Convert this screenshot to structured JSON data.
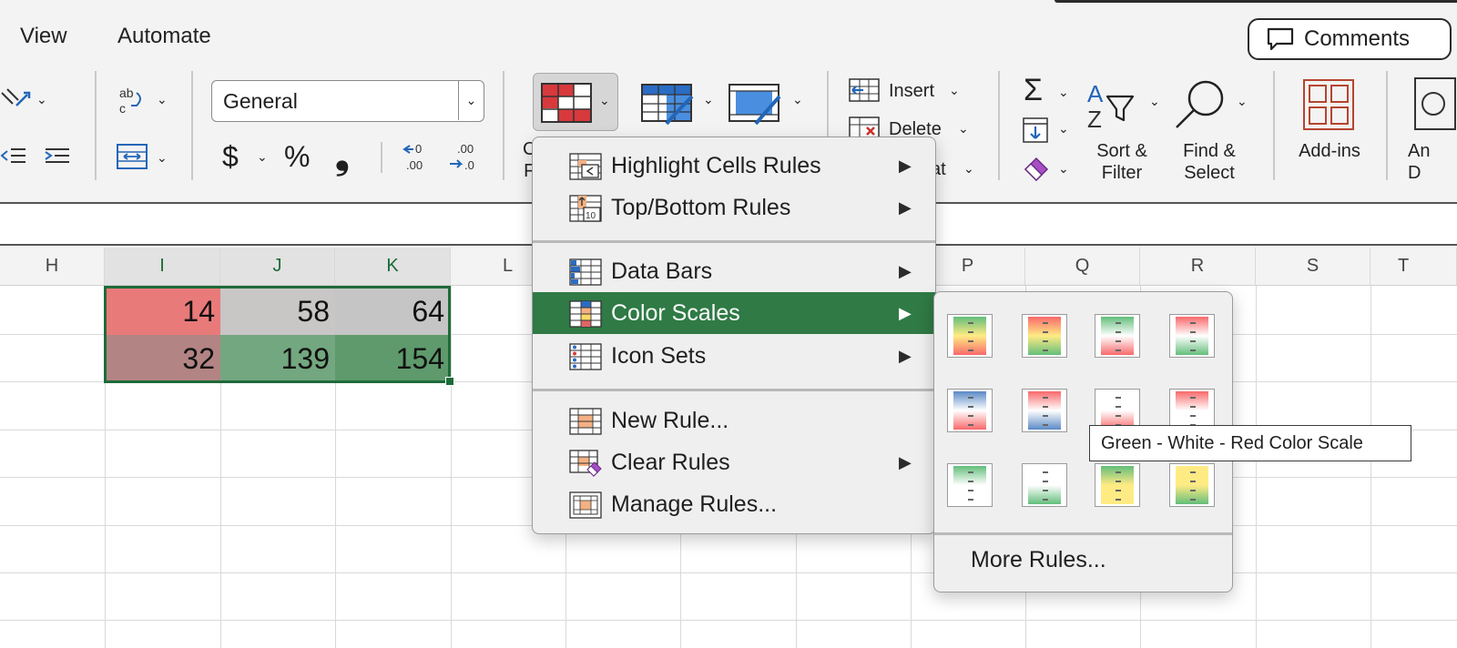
{
  "ribbon": {
    "tabs": [
      "View",
      "Automate"
    ],
    "comments_label": "Comments",
    "number_format": "General",
    "currency_symbol": "$",
    "percent_symbol": "%",
    "comma_symbol": "❟",
    "insert_label": "Insert",
    "delete_label": "Delete",
    "format_label_partial": "at",
    "sort_filter_label": [
      "Sort &",
      "Filter"
    ],
    "find_select_label": [
      "Find &",
      "Select"
    ],
    "addins_label": "Add-ins",
    "partial_label_right": [
      "An",
      "D"
    ]
  },
  "grid": {
    "columns": [
      "H",
      "I",
      "J",
      "K",
      "L",
      "P",
      "Q",
      "R",
      "S",
      "T"
    ],
    "rows": [
      [
        {
          "value": "14",
          "color": "#e97a7a"
        },
        {
          "value": "58",
          "color": "#c9c6c6"
        },
        {
          "value": "64",
          "color": "#c5c5c5"
        }
      ],
      [
        {
          "value": "32",
          "color": "#b38484"
        },
        {
          "value": "139",
          "color": "#73a77f"
        },
        {
          "value": "154",
          "color": "#5e9a6c"
        }
      ]
    ]
  },
  "menu": {
    "items": [
      {
        "label": "Highlight Cells Rules",
        "has_submenu": true
      },
      {
        "label": "Top/Bottom Rules",
        "has_submenu": true
      },
      {
        "label": "Data Bars",
        "has_submenu": true
      },
      {
        "label": "Color Scales",
        "has_submenu": true,
        "highlighted": true
      },
      {
        "label": "Icon Sets",
        "has_submenu": true
      },
      {
        "label": "New Rule...",
        "has_submenu": false
      },
      {
        "label": "Clear Rules",
        "has_submenu": true
      },
      {
        "label": "Manage Rules...",
        "has_submenu": false
      }
    ],
    "highlight_color": "#2f7a45"
  },
  "submenu": {
    "swatches": [
      [
        "#63be7b",
        "#ffeb84",
        "#f8696b"
      ],
      [
        "#f8696b",
        "#ffeb84",
        "#63be7b"
      ],
      [
        "#63be7b",
        "#ffffff",
        "#f8696b"
      ],
      [
        "#f8696b",
        "#ffffff",
        "#63be7b"
      ],
      [
        "#5a8ac6",
        "#ffffff",
        "#f8696b"
      ],
      [
        "#f8696b",
        "#ffffff",
        "#5a8ac6"
      ],
      [
        "#ffffff",
        "#ffffff",
        "#f8696b"
      ],
      [
        "#f8696b",
        "#ffffff",
        "#ffffff"
      ],
      [
        "#63be7b",
        "#ffffff",
        "#ffffff"
      ],
      [
        "#ffffff",
        "#ffffff",
        "#63be7b"
      ],
      [
        "#63be7b",
        "#ffeb84",
        "#ffeb84"
      ],
      [
        "#ffeb84",
        "#ffeb84",
        "#63be7b"
      ]
    ],
    "more_rules_label": "More Rules...",
    "tooltip": "Green - White - Red Color Scale"
  }
}
